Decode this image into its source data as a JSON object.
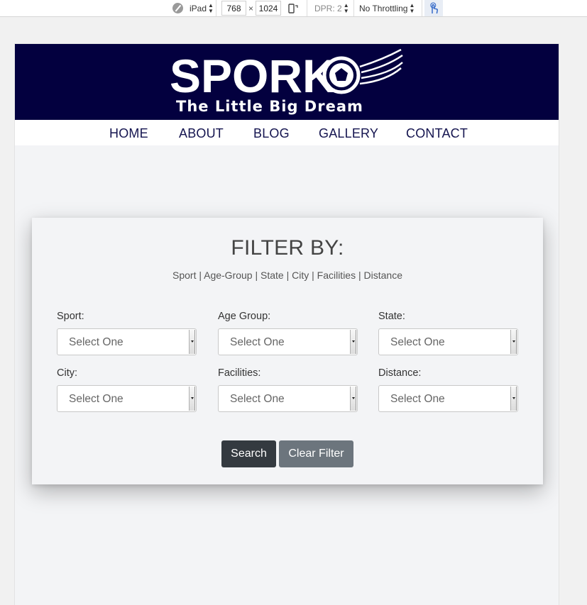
{
  "devtools": {
    "device": "iPad",
    "width": "768",
    "times": "×",
    "height": "1024",
    "dpr": "DPR: 2",
    "throttling": "No Throttling"
  },
  "site": {
    "logo_text": "SPORK",
    "tagline": "The Little Big Dream",
    "nav": [
      "HOME",
      "ABOUT",
      "BLOG",
      "GALLERY",
      "CONTACT"
    ]
  },
  "filter": {
    "title": "FILTER BY:",
    "subtitle": "Sport | Age-Group | State | City | Facilities | Distance",
    "fields": [
      {
        "label": "Sport:",
        "value": "Select One"
      },
      {
        "label": "Age Group:",
        "value": "Select One"
      },
      {
        "label": "State:",
        "value": "Select One"
      },
      {
        "label": "City:",
        "value": "Select One"
      },
      {
        "label": "Facilities:",
        "value": "Select One"
      },
      {
        "label": "Distance:",
        "value": "Select One"
      }
    ],
    "search_label": "Search",
    "clear_label": "Clear Filter"
  },
  "colors": {
    "banner": "#03003f",
    "nav_text": "#14144f",
    "search_button": "#343a40",
    "clear_button": "#6c757d"
  }
}
